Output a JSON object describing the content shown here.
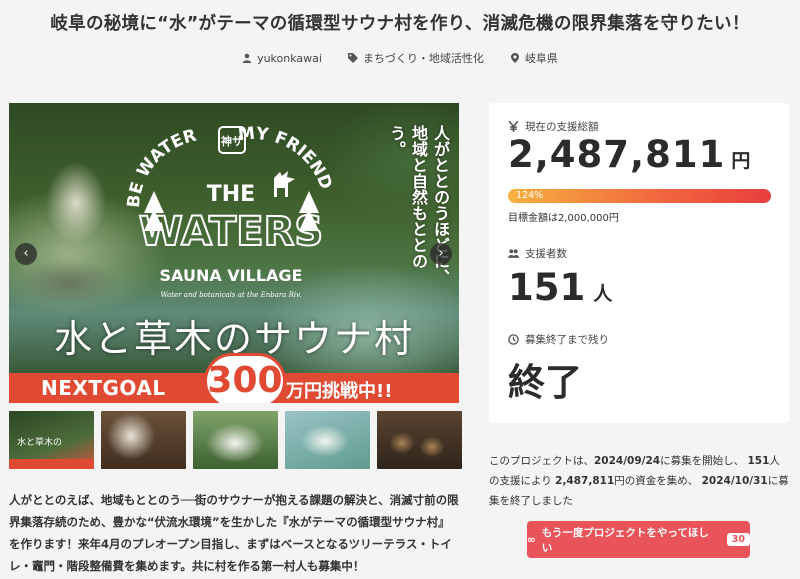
{
  "title": "岐阜の秘境に“水”がテーマの循環型サウナ村を作り、消滅危機の限界集落を守りたい！",
  "meta": {
    "author": "yukonkawai",
    "category": "まちづくり・地域活性化",
    "location": "岐阜県"
  },
  "hero": {
    "logo_arc_left": "BE WATER",
    "logo_arc_right": "MY FRIEND",
    "logo_badge": "神サ",
    "logo_the": "THE",
    "logo_waters": "WATERS",
    "logo_sub": "SAUNA VILLAGE",
    "logo_caption": "Water and botanicals at the Enbara Riv.",
    "vertical_copy": "人がととのうほどに、地域と自然もととのう。",
    "big_text": "水と草木のサウナ村",
    "goal_left": "NEXTGOAL",
    "goal_number": "300",
    "goal_right": "万円挑戦中!!",
    "prev_arrow": "‹",
    "next_arrow": "›"
  },
  "thumbnails": [
    "thumb-1",
    "thumb-2",
    "thumb-3",
    "thumb-4",
    "thumb-5"
  ],
  "thumb1_text": "水と草木の",
  "description": "人がととのえば、地域もととのう──街のサウナーが抱える課題の解決と、消滅寸前の限界集落存続のため、豊かな“伏流水環境”を生かした『水がテーマの循環型サウナ村』を作ります！来年4月のプレオープン目指し、まずはベースとなるツリーテラス・トイレ・竈門・階段整備費を集めます。共に村を作る第一村人も募集中！",
  "stats": {
    "raised_label": "現在の支援総額",
    "raised_value": "2,487,811",
    "raised_unit": "円",
    "progress_label": "124%",
    "progress_fraction": 1.0,
    "goal_text": "目標金額は2,000,000円",
    "supporters_label": "支援者数",
    "supporters_value": "151",
    "supporters_unit": "人",
    "remaining_label": "募集終了まで残り",
    "remaining_value": "終了"
  },
  "info": {
    "p1": "このプロジェクトは、",
    "start": "2024/09/24",
    "p2": "に募集を開始し、",
    "count": "151",
    "p3": "人の支援により",
    "amount": "2,487,811",
    "p4": "円の資金を集め、",
    "end": "2024/10/31",
    "p5": "に募集を終了しました"
  },
  "cta": {
    "label": "もう一度プロジェクトをやってほしい",
    "count": "30"
  },
  "colors": {
    "accent": "#e8545a",
    "goal_band": "#e04a33",
    "progress_start": "#f5b13f",
    "progress_end": "#e83e3e"
  },
  "icons": [
    "user-icon",
    "tag-icon",
    "pin-icon",
    "yen-icon",
    "people-icon",
    "clock-icon",
    "infinity-icon"
  ]
}
